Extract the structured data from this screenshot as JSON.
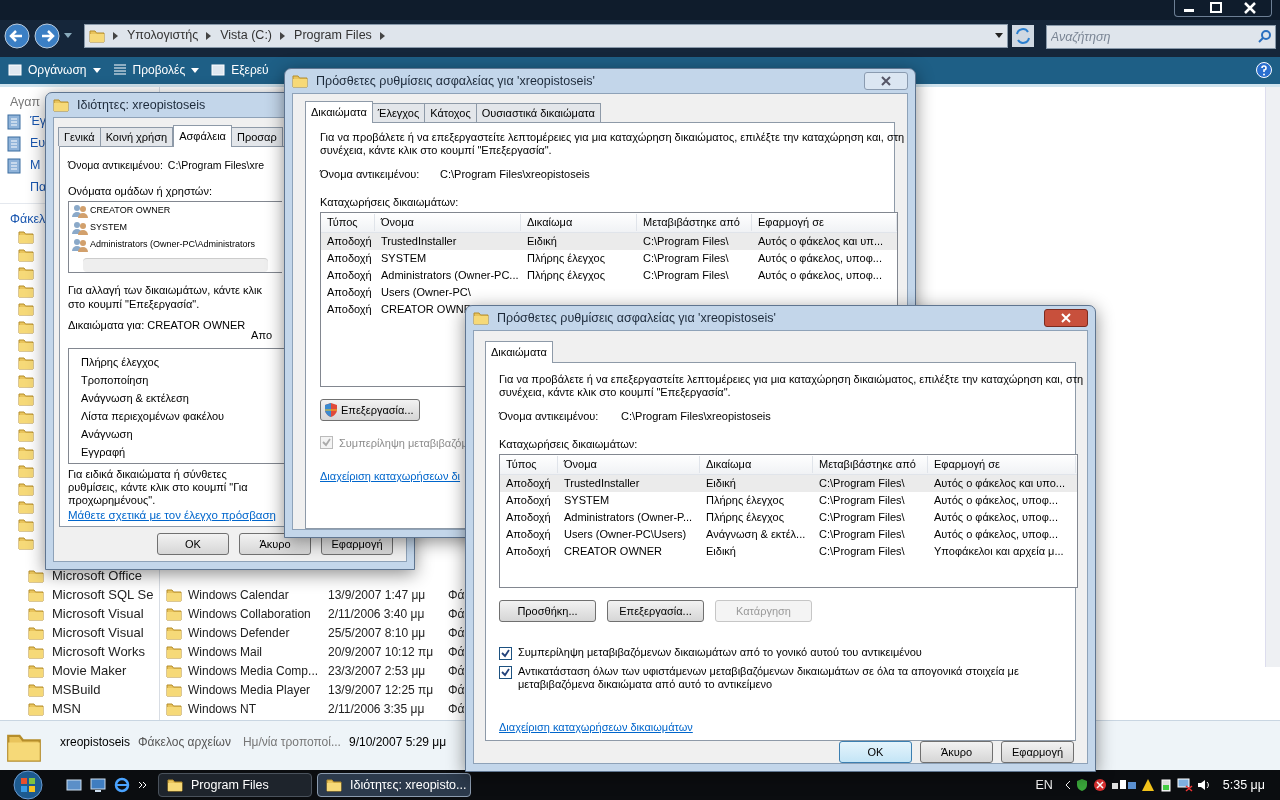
{
  "explorer": {
    "breadcrumbs": [
      "Υπολογιστής",
      "Vista (C:)",
      "Program Files"
    ],
    "search": {
      "placeholder": "Αναζήτηση"
    },
    "toolbar": [
      {
        "label": "Οργάνωση",
        "dropdown": true
      },
      {
        "label": "Προβολές",
        "dropdown": true
      },
      {
        "label": "Εξερεύ",
        "dropdown": false
      }
    ],
    "nav": {
      "header": "Αγαπ",
      "links": [
        "Έγ",
        "Ευ",
        "Μ",
        "Πα"
      ],
      "folders_header": "Φάκελ"
    },
    "tree": [
      "Microsoft Office",
      "Microsoft SQL Se",
      "Microsoft Visual",
      "Microsoft Visual",
      "Microsoft Works",
      "Movie Maker",
      "MSBuild",
      "MSN"
    ],
    "files": [
      {
        "name": "Windows Calendar",
        "date": "13/9/2007 1:47 μμ",
        "type": "Φά"
      },
      {
        "name": "Windows Collaboration",
        "date": "2/11/2006 3:40 μμ",
        "type": "Φά"
      },
      {
        "name": "Windows Defender",
        "date": "25/5/2007 8:10 μμ",
        "type": "Φά"
      },
      {
        "name": "Windows Mail",
        "date": "20/9/2007 10:12 πμ",
        "type": "Φά"
      },
      {
        "name": "Windows Media Comp...",
        "date": "23/3/2007 2:53 μμ",
        "type": "Φά"
      },
      {
        "name": "Windows Media Player",
        "date": "13/9/2007 12:25 πμ",
        "type": "Φά"
      },
      {
        "name": "Windows NT",
        "date": "2/11/2006 3:35 μμ",
        "type": "Φά"
      }
    ],
    "details": {
      "name": "xreopistoseis",
      "kind": "Φάκελος αρχείων",
      "date_label": "Ημ/νία τροποποί...",
      "date": "9/10/2007 5:29 μμ"
    }
  },
  "properties": {
    "title": "Ιδιότητες: xreopistoseis",
    "tabs": [
      {
        "label": "Γενικά",
        "selected": false
      },
      {
        "label": "Κοινή χρήση",
        "selected": false
      },
      {
        "label": "Ασφάλεια",
        "selected": true
      },
      {
        "label": "Προσαρ",
        "selected": false
      }
    ],
    "object_label": "Όνομα αντικειμένου:",
    "object_value": "C:\\Program Files\\xre",
    "groups_label": "Ονόματα ομάδων ή χρηστών:",
    "groups": [
      "CREATOR OWNER",
      "SYSTEM",
      "Administrators (Owner-PC\\Administrators"
    ],
    "change_hint": "Για αλλαγή των δικαιωμάτων, κάντε κλικ στο κουμπί \"Επεξεργασία\".",
    "permissions_for": "Δικαιώματα για: CREATOR OWNER",
    "column_2": "Απο",
    "permissions": [
      "Πλήρης έλεγχος",
      "Τροποποίηση",
      "Ανάγνωση & εκτέλεση",
      "Λίστα περιεχομένων φακέλου",
      "Ανάγνωση",
      "Εγγραφή"
    ],
    "advanced_hint": "Για ειδικά δικαιώματα ή σύνθετες ρυθμίσεις, κάντε κλικ στο κουμπί \"Για προχωρημένους\".",
    "link": "Μάθετε σχετικά με τον έλεγχο πρόσβαση",
    "buttons": [
      "OK",
      "Άκυρο",
      "Εφαρμογή"
    ]
  },
  "advanced_back": {
    "title": "Πρόσθετες ρυθμίσεις ασφαλείας για 'xreopistoseis'",
    "tabs": [
      {
        "label": "Δικαιώματα",
        "selected": true
      },
      {
        "label": "Έλεγχος",
        "selected": false
      },
      {
        "label": "Κάτοχος",
        "selected": false
      },
      {
        "label": "Ουσιαστικά δικαιώματα",
        "selected": false
      }
    ],
    "description": "Για να προβάλετε ή να επεξεργαστείτε λεπτομέρειες για μια καταχώρηση δικαιώματος, επιλέξτε την καταχώρηση και, στη συνέχεια, κάντε κλικ στο κουμπί \"Επεξεργασία\".",
    "object_label": "Όνομα αντικειμένου:",
    "object_value": "C:\\Program Files\\xreopistoseis",
    "entries_label": "Καταχωρήσεις δικαιωμάτων:",
    "columns": [
      "Τύπος",
      "Όνομα",
      "Δικαίωμα",
      "Μεταβιβάστηκε από",
      "Εφαρμογή σε"
    ],
    "rows": [
      {
        "cells": [
          "Αποδοχή",
          "TrustedInstaller",
          "Ειδική",
          "C:\\Program Files\\",
          "Αυτός ο φάκελος και υπ..."
        ],
        "selected": true
      },
      {
        "cells": [
          "Αποδοχή",
          "SYSTEM",
          "Πλήρης έλεγχος",
          "C:\\Program Files\\",
          "Αυτός ο φάκελος, υποφ..."
        ],
        "selected": false
      },
      {
        "cells": [
          "Αποδοχή",
          "Administrators (Owner-PC...",
          "Πλήρης έλεγχος",
          "C:\\Program Files\\",
          "Αυτός ο φάκελος, υποφ..."
        ],
        "selected": false
      },
      {
        "cells": [
          "Αποδοχή",
          "Users (Owner-PC\\"
        ],
        "selected": false
      },
      {
        "cells": [
          "Αποδοχή",
          "CREATOR OWNE"
        ],
        "selected": false
      }
    ],
    "edit_button": "Επεξεργασία...",
    "checkbox": {
      "label": "Συμπερίληψη μεταβιβαζόμ",
      "checked": true,
      "disabled": true
    },
    "link": "Διαχείριση καταχωρήσεων δι"
  },
  "advanced_front": {
    "title": "Πρόσθετες ρυθμίσεις ασφαλείας για 'xreopistoseis'",
    "tabs": [
      {
        "label": "Δικαιώματα",
        "selected": true
      }
    ],
    "description": "Για να προβάλετε ή να επεξεργαστείτε λεπτομέρειες για μια καταχώρηση δικαιώματος, επιλέξτε την καταχώρηση και, στη συνέχεια, κάντε κλικ στο κουμπί \"Επεξεργασία\".",
    "object_label": "Όνομα αντικειμένου:",
    "object_value": "C:\\Program Files\\xreopistoseis",
    "entries_label": "Καταχωρήσεις δικαιωμάτων:",
    "columns": [
      "Τύπος",
      "Όνομα",
      "Δικαίωμα",
      "Μεταβιβάστηκε από",
      "Εφαρμογή σε"
    ],
    "rows": [
      {
        "cells": [
          "Αποδοχή",
          "TrustedInstaller",
          "Ειδική",
          "C:\\Program Files\\",
          "Αυτός ο φάκελος και υπο..."
        ],
        "selected": true
      },
      {
        "cells": [
          "Αποδοχή",
          "SYSTEM",
          "Πλήρης έλεγχος",
          "C:\\Program Files\\",
          "Αυτός ο φάκελος, υποφ..."
        ],
        "selected": false
      },
      {
        "cells": [
          "Αποδοχή",
          "Administrators (Owner-P...",
          "Πλήρης έλεγχος",
          "C:\\Program Files\\",
          "Αυτός ο φάκελος, υποφ..."
        ],
        "selected": false
      },
      {
        "cells": [
          "Αποδοχή",
          "Users (Owner-PC\\Users)",
          "Ανάγνωση & εκτέλ...",
          "C:\\Program Files\\",
          "Αυτός ο φάκελος, υποφ..."
        ],
        "selected": false
      },
      {
        "cells": [
          "Αποδοχή",
          "CREATOR OWNER",
          "Ειδική",
          "C:\\Program Files\\",
          "Υποφάκελοι και αρχεία μ..."
        ],
        "selected": false
      }
    ],
    "buttons": [
      {
        "label": "Προσθήκη...",
        "disabled": false
      },
      {
        "label": "Επεξεργασία...",
        "disabled": false
      },
      {
        "label": "Κατάργηση",
        "disabled": true
      }
    ],
    "checkboxes": [
      {
        "label": "Συμπερίληψη μεταβιβαζόμενων δικαιωμάτων από το γονικό αυτού του αντικειμένου",
        "checked": true
      },
      {
        "label": "Αντικατάσταση όλων των υφιστάμενων μεταβιβαζόμενων δικαιωμάτων σε όλα τα απογονικά στοιχεία με μεταβιβαζόμενα δικαιώματα από αυτό το αντικείμενο",
        "checked": true
      }
    ],
    "link": "Διαχείριση καταχωρήσεων δικαιωμάτων",
    "footer_buttons": [
      {
        "label": "OK",
        "default": true
      },
      {
        "label": "Άκυρο",
        "default": false
      },
      {
        "label": "Εφαρμογή",
        "default": false
      }
    ]
  },
  "taskbar": {
    "buttons": [
      {
        "label": "Program Files",
        "selected": false
      },
      {
        "label": "Ιδιότητες: xreopisto...",
        "selected": true
      }
    ],
    "language": "EN",
    "clock": "5:35 μμ"
  }
}
